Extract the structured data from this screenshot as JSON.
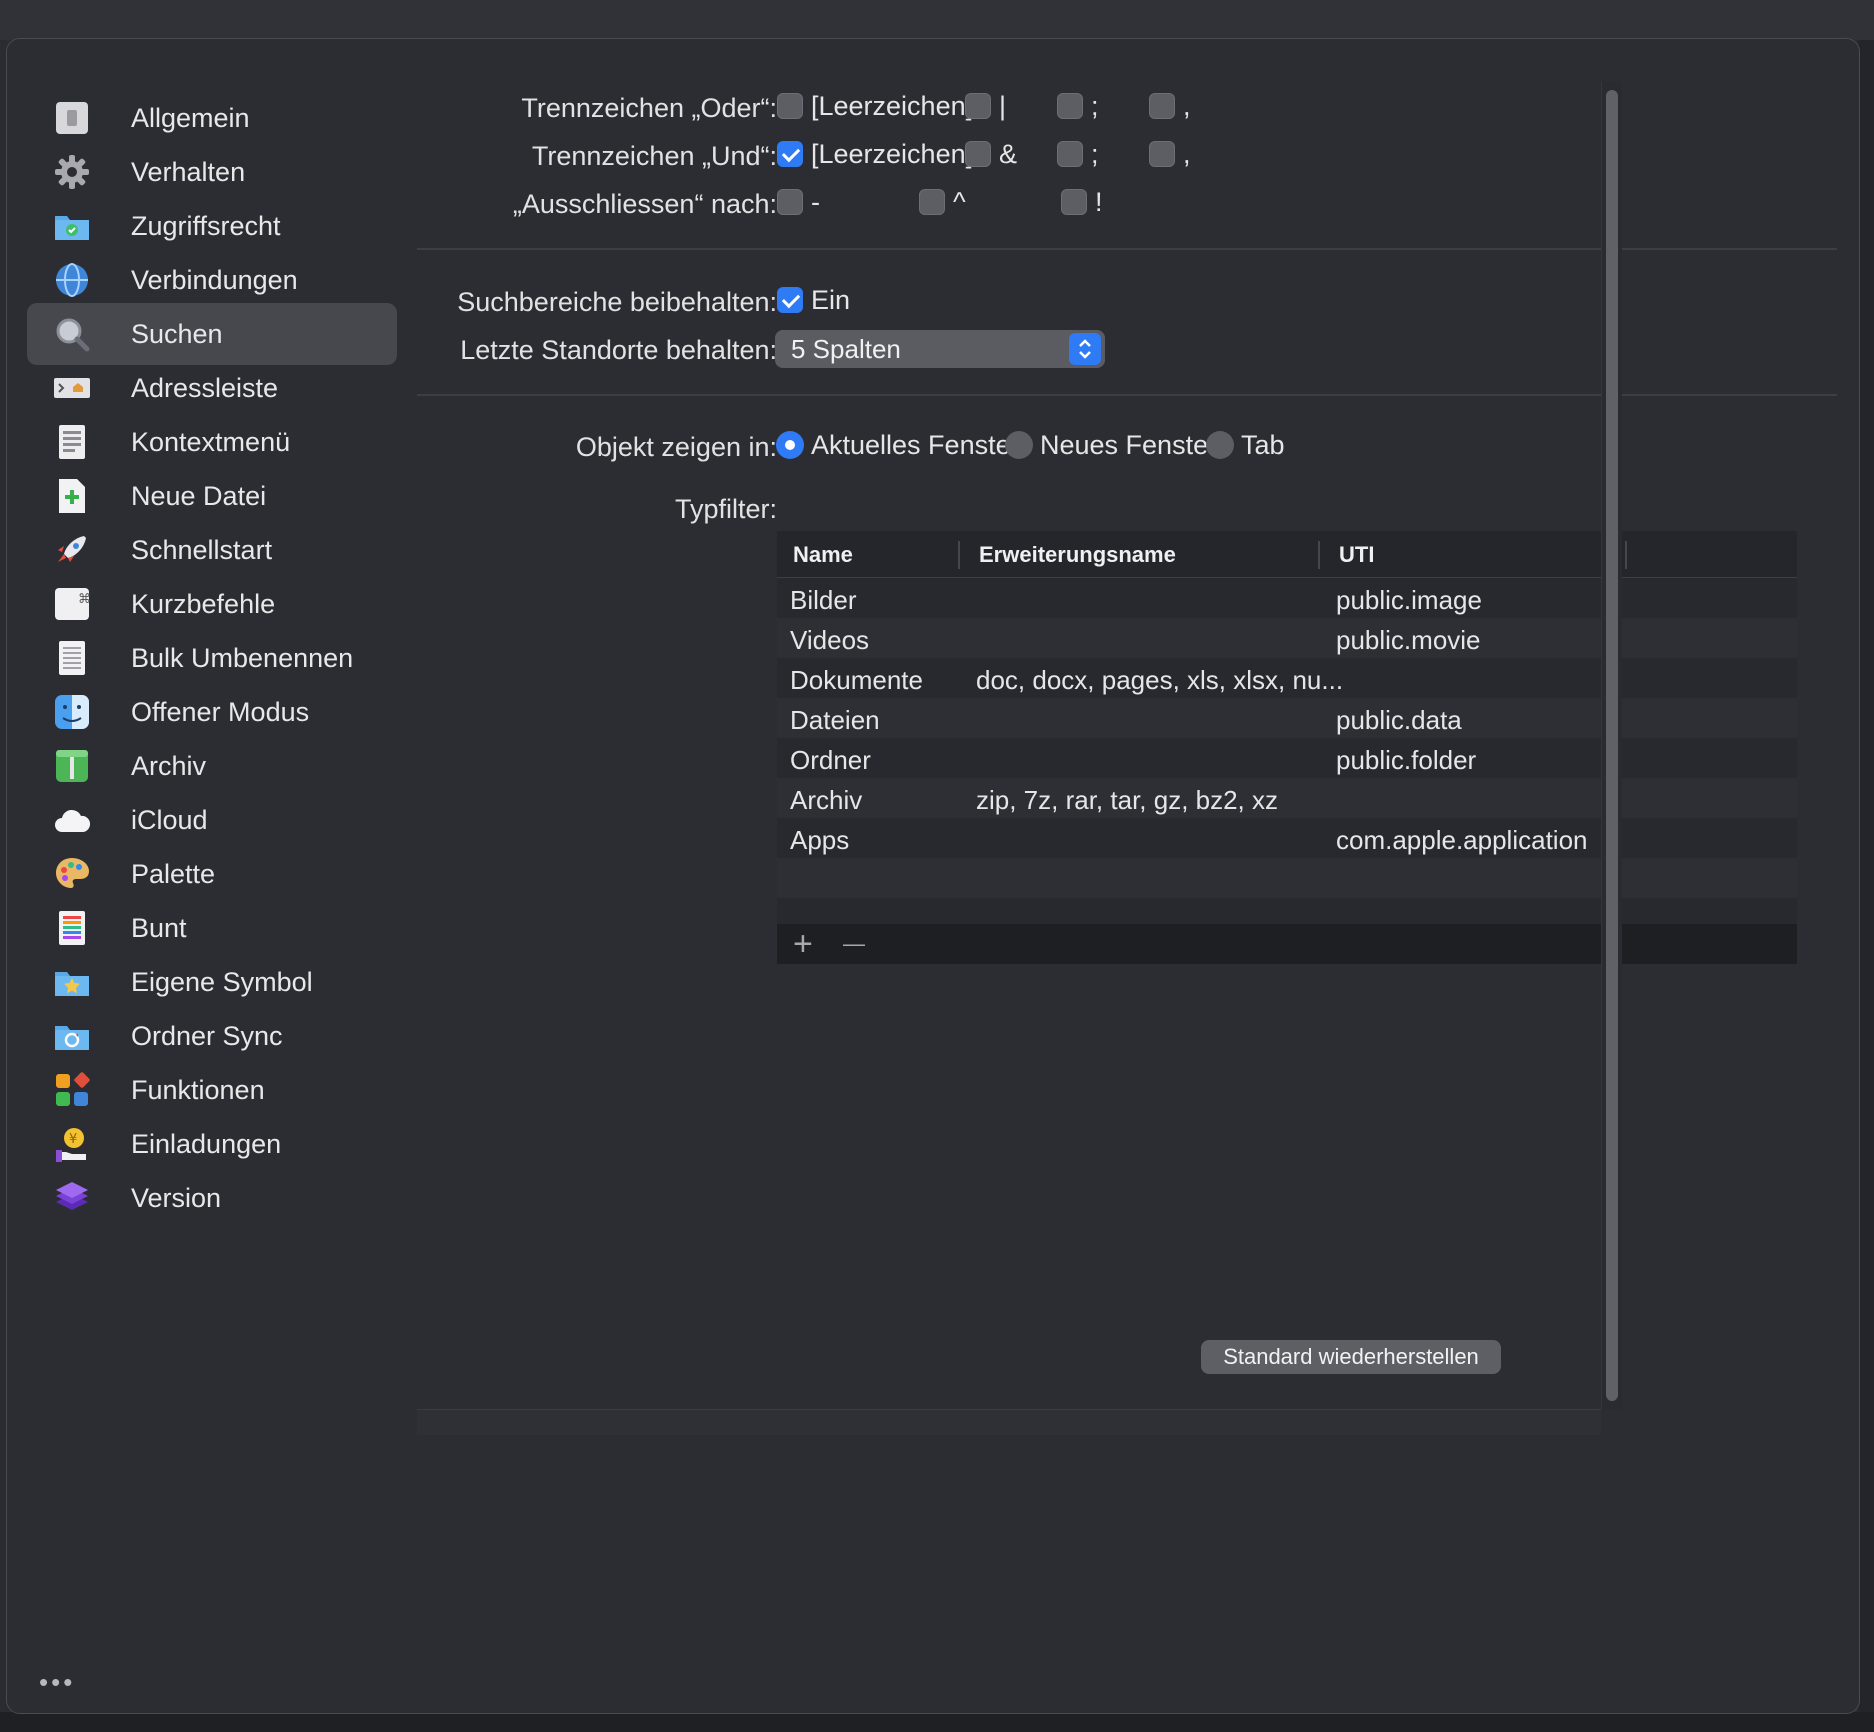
{
  "sidebar": {
    "items": [
      {
        "label": "Allgemein",
        "icon": "switch-icon"
      },
      {
        "label": "Verhalten",
        "icon": "gear-icon"
      },
      {
        "label": "Zugriffsrecht",
        "icon": "folder-check-icon"
      },
      {
        "label": "Verbindungen",
        "icon": "globe-icon"
      },
      {
        "label": "Suchen",
        "icon": "magnifier-icon",
        "selected": true
      },
      {
        "label": "Adressleiste",
        "icon": "address-bar-icon"
      },
      {
        "label": "Kontextmenü",
        "icon": "context-menu-icon"
      },
      {
        "label": "Neue Datei",
        "icon": "new-file-icon"
      },
      {
        "label": "Schnellstart",
        "icon": "rocket-icon"
      },
      {
        "label": "Kurzbefehle",
        "icon": "command-key-icon"
      },
      {
        "label": "Bulk Umbenennen",
        "icon": "list-document-icon"
      },
      {
        "label": "Offener Modus",
        "icon": "finder-icon"
      },
      {
        "label": "Archiv",
        "icon": "archive-icon"
      },
      {
        "label": "iCloud",
        "icon": "cloud-icon"
      },
      {
        "label": "Palette",
        "icon": "palette-icon"
      },
      {
        "label": "Bunt",
        "icon": "colorful-list-icon"
      },
      {
        "label": "Eigene Symbol",
        "icon": "folder-star-icon"
      },
      {
        "label": "Ordner Sync",
        "icon": "folder-sync-icon"
      },
      {
        "label": "Funktionen",
        "icon": "shapes-icon"
      },
      {
        "label": "Einladungen",
        "icon": "coin-hand-icon"
      },
      {
        "label": "Version",
        "icon": "layers-icon"
      }
    ],
    "more": "•••"
  },
  "separators": {
    "or": {
      "label": "Trennzeichen „Oder“:",
      "options": [
        {
          "label": "[Leerzeichen]",
          "checked": false
        },
        {
          "label": "|",
          "checked": false
        },
        {
          "label": ";",
          "checked": false
        },
        {
          "label": ",",
          "checked": false
        }
      ]
    },
    "and": {
      "label": "Trennzeichen „Und“:",
      "options": [
        {
          "label": "[Leerzeichen]",
          "checked": true
        },
        {
          "label": "&",
          "checked": false
        },
        {
          "label": ";",
          "checked": false
        },
        {
          "label": ",",
          "checked": false
        }
      ]
    },
    "exclude": {
      "label": "„Ausschliessen“ nach:",
      "options": [
        {
          "label": "-",
          "checked": false
        },
        {
          "label": "^",
          "checked": false
        },
        {
          "label": "!",
          "checked": false
        }
      ]
    }
  },
  "keep_scopes": {
    "label": "Suchbereiche beibehalten:",
    "option_label": "Ein",
    "checked": true
  },
  "recent_locations": {
    "label": "Letzte Standorte behalten:",
    "value": "5 Spalten"
  },
  "show_in": {
    "label": "Objekt zeigen in:",
    "options": [
      {
        "label": "Aktuelles Fenster",
        "selected": true
      },
      {
        "label": "Neues Fenster",
        "selected": false
      },
      {
        "label": "Tab",
        "selected": false
      }
    ]
  },
  "type_filter": {
    "label": "Typfilter:",
    "columns": [
      "Name",
      "Erweiterungsname",
      "UTI"
    ],
    "rows": [
      [
        "Bilder",
        "",
        "public.image"
      ],
      [
        "Videos",
        "",
        "public.movie"
      ],
      [
        "Dokumente",
        "doc, docx, pages, xls, xlsx, nu...",
        ""
      ],
      [
        "Dateien",
        "",
        "public.data"
      ],
      [
        "Ordner",
        "",
        "public.folder"
      ],
      [
        "Archiv",
        "zip, 7z, rar, tar, gz, bz2, xz",
        ""
      ],
      [
        "Apps",
        "",
        "com.apple.application"
      ]
    ],
    "add_label": "+",
    "remove_label": "—"
  },
  "restore_button": "Standard wiederherstellen",
  "colors": {
    "accent": "#2f7af5",
    "close": "#ec5b55",
    "window_bg": "#2c2d32",
    "selected_bg": "#47484e"
  }
}
